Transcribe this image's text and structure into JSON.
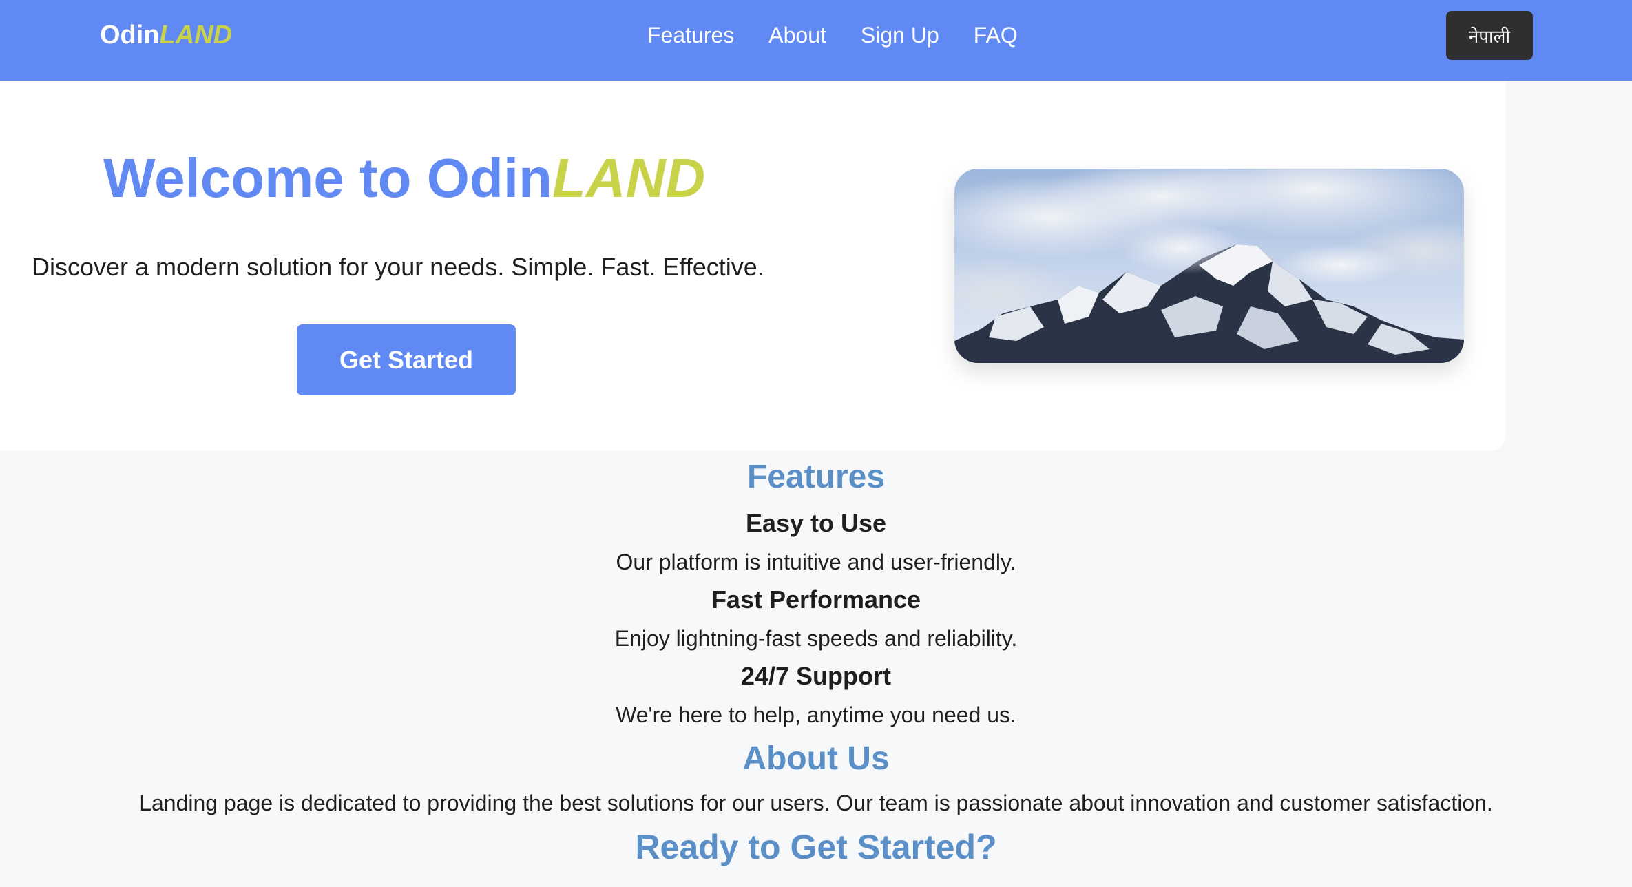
{
  "brand": {
    "name": "Odin",
    "accent": "LAND"
  },
  "nav": {
    "links": [
      {
        "label": "Features"
      },
      {
        "label": "About"
      },
      {
        "label": "Sign Up"
      },
      {
        "label": "FAQ"
      }
    ],
    "language_button": "नेपाली"
  },
  "hero": {
    "title_prefix": "Welcome to Odin",
    "title_accent": "LAND",
    "subtitle": "Discover a modern solution for your needs. Simple. Fast. Effective.",
    "cta_label": "Get Started"
  },
  "features": {
    "heading": "Features",
    "items": [
      {
        "title": "Easy to Use",
        "description": "Our platform is intuitive and user-friendly."
      },
      {
        "title": "Fast Performance",
        "description": "Enjoy lightning-fast speeds and reliability."
      },
      {
        "title": "24/7 Support",
        "description": "We're here to help, anytime you need us."
      }
    ]
  },
  "about": {
    "heading": "About Us",
    "text": "Landing page is dedicated to providing the best solutions for our users. Our team is passionate about innovation and customer satisfaction."
  },
  "signup": {
    "heading": "Ready to Get Started?"
  },
  "colors": {
    "primary": "#6089f4",
    "accent": "#c9d34a",
    "section_heading": "#5a90c7",
    "dark_button": "#2f2f2f",
    "background": "#f7f8fa"
  },
  "icons": {
    "hero_image": "snowy-mountain-image"
  }
}
